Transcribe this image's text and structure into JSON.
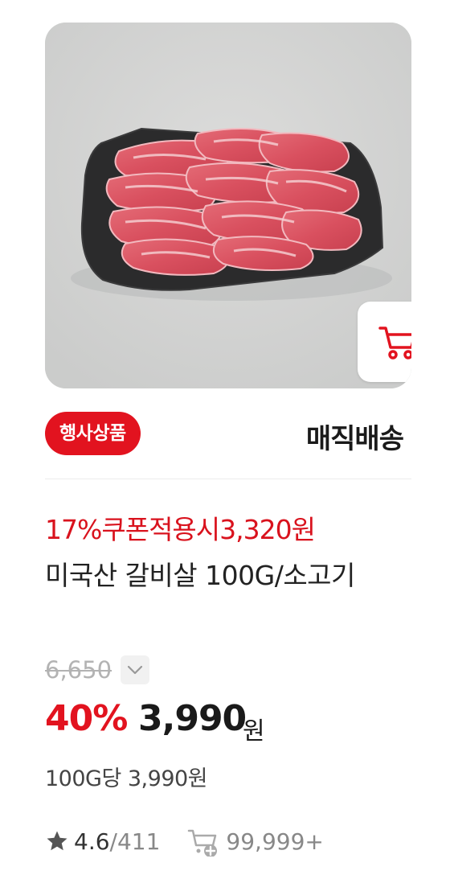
{
  "product": {
    "image_alt": "beef rib slices on black slate",
    "badge": "행사상품",
    "delivery": "매직배송",
    "coupon": "17%쿠폰적용시3,320원",
    "name": "미국산 갈비살 100G/소고기",
    "original_price": "6,650",
    "discount": "40%",
    "price": "3,990",
    "currency": "원",
    "unit_price": "100G당 3,990원",
    "rating": "4.6",
    "review_count": "/411",
    "cart_count": "99,999+"
  },
  "icons": {
    "cart_button": "shopping-cart-icon",
    "price_toggle": "chevron-down-icon",
    "rating": "star-icon",
    "cart_count": "cart-plus-icon"
  },
  "colors": {
    "accent": "#e2131f",
    "coupon": "#d9121d",
    "text": "#1a1a1a",
    "muted": "#888888"
  }
}
